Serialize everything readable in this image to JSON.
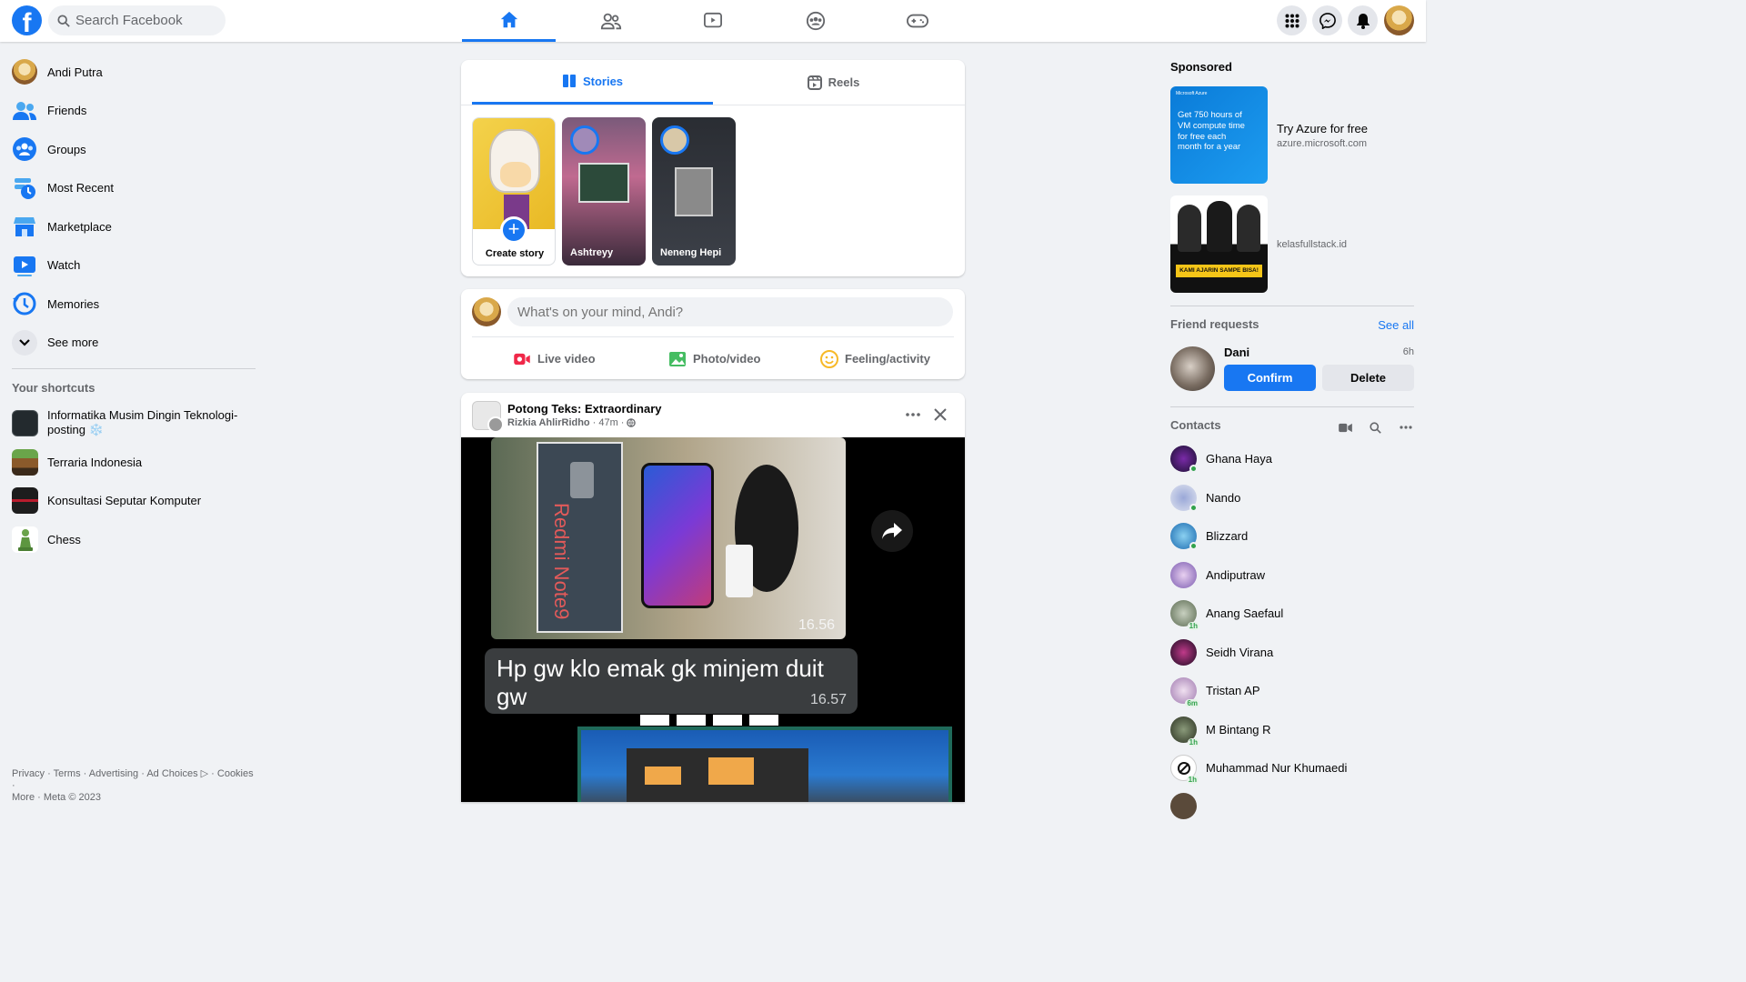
{
  "header": {
    "logo": "f",
    "search_placeholder": "Search Facebook",
    "nav_icons": [
      "home-icon",
      "friends-icon",
      "watch-icon",
      "groups-icon",
      "gaming-icon"
    ],
    "right_icons": [
      "menu-grid-icon",
      "messenger-icon",
      "notifications-icon"
    ]
  },
  "sidebar": {
    "items": [
      {
        "label": "Andi Putra",
        "icon": "profile-avatar"
      },
      {
        "label": "Friends",
        "icon": "friends-icon"
      },
      {
        "label": "Groups",
        "icon": "groups-icon"
      },
      {
        "label": "Most Recent",
        "icon": "most-recent-icon"
      },
      {
        "label": "Marketplace",
        "icon": "marketplace-icon"
      },
      {
        "label": "Watch",
        "icon": "watch-icon"
      },
      {
        "label": "Memories",
        "icon": "memories-icon"
      },
      {
        "label": "See more",
        "icon": "chevron-down-icon"
      }
    ],
    "shortcuts_title": "Your shortcuts",
    "shortcuts": [
      {
        "label": "Informatika Musim Dingin Teknologi-posting ❄️"
      },
      {
        "label": "Terraria Indonesia"
      },
      {
        "label": "Konsultasi Seputar Komputer"
      },
      {
        "label": "Chess"
      }
    ],
    "footer_line1": "Privacy · Terms · Advertising · Ad Choices ▷ · Cookies ·",
    "footer_line2": "More · Meta © 2023"
  },
  "stories": {
    "tabs": [
      {
        "label": "Stories"
      },
      {
        "label": "Reels"
      }
    ],
    "create_label": "Create story",
    "items": [
      {
        "name": "Ashtreyy"
      },
      {
        "name": "Neneng Hepi"
      }
    ]
  },
  "composer": {
    "placeholder": "What's on your mind, Andi?",
    "actions": [
      {
        "label": "Live video"
      },
      {
        "label": "Photo/video"
      },
      {
        "label": "Feeling/activity"
      }
    ]
  },
  "post": {
    "group": "Potong Teks: Extraordinary",
    "author": "Rizkia AhlirRidho",
    "time": "47m",
    "image_texts": {
      "brand": "Redmi Note9",
      "time1": "16.56",
      "caption": "Hp gw klo emak gk minjem duit gw",
      "time2": "16.57"
    }
  },
  "sponsored": {
    "title": "Sponsored",
    "ads": [
      {
        "title": "Try Azure for free",
        "domain": "azure.microsoft.com",
        "image_text": "Get 750 hours of VM compute time for free each month for a year",
        "image_brand": "Microsoft Azure"
      },
      {
        "title": "",
        "domain": "kelasfullstack.id",
        "image_text": "KAMI AJARIN SAMPE BISA!"
      }
    ]
  },
  "friend_requests": {
    "title": "Friend requests",
    "see_all": "See all",
    "items": [
      {
        "name": "Dani",
        "time": "6h",
        "confirm": "Confirm",
        "delete": "Delete"
      }
    ]
  },
  "contacts": {
    "title": "Contacts",
    "items": [
      {
        "name": "Ghana Haya",
        "status": "online"
      },
      {
        "name": "Nando",
        "status": "online"
      },
      {
        "name": "Blizzard",
        "status": "online"
      },
      {
        "name": "Andiputraw",
        "status": ""
      },
      {
        "name": "Anang Saefaul",
        "status": "1h"
      },
      {
        "name": "Seidh Virana",
        "status": ""
      },
      {
        "name": "Tristan AP",
        "status": "6m"
      },
      {
        "name": "M Bintang R",
        "status": "1h"
      },
      {
        "name": "Muhammad Nur Khumaedi",
        "status": "1h"
      }
    ]
  },
  "colors": {
    "brand": "#1877f2",
    "background": "#f0f2f5",
    "online": "#31a24c"
  }
}
